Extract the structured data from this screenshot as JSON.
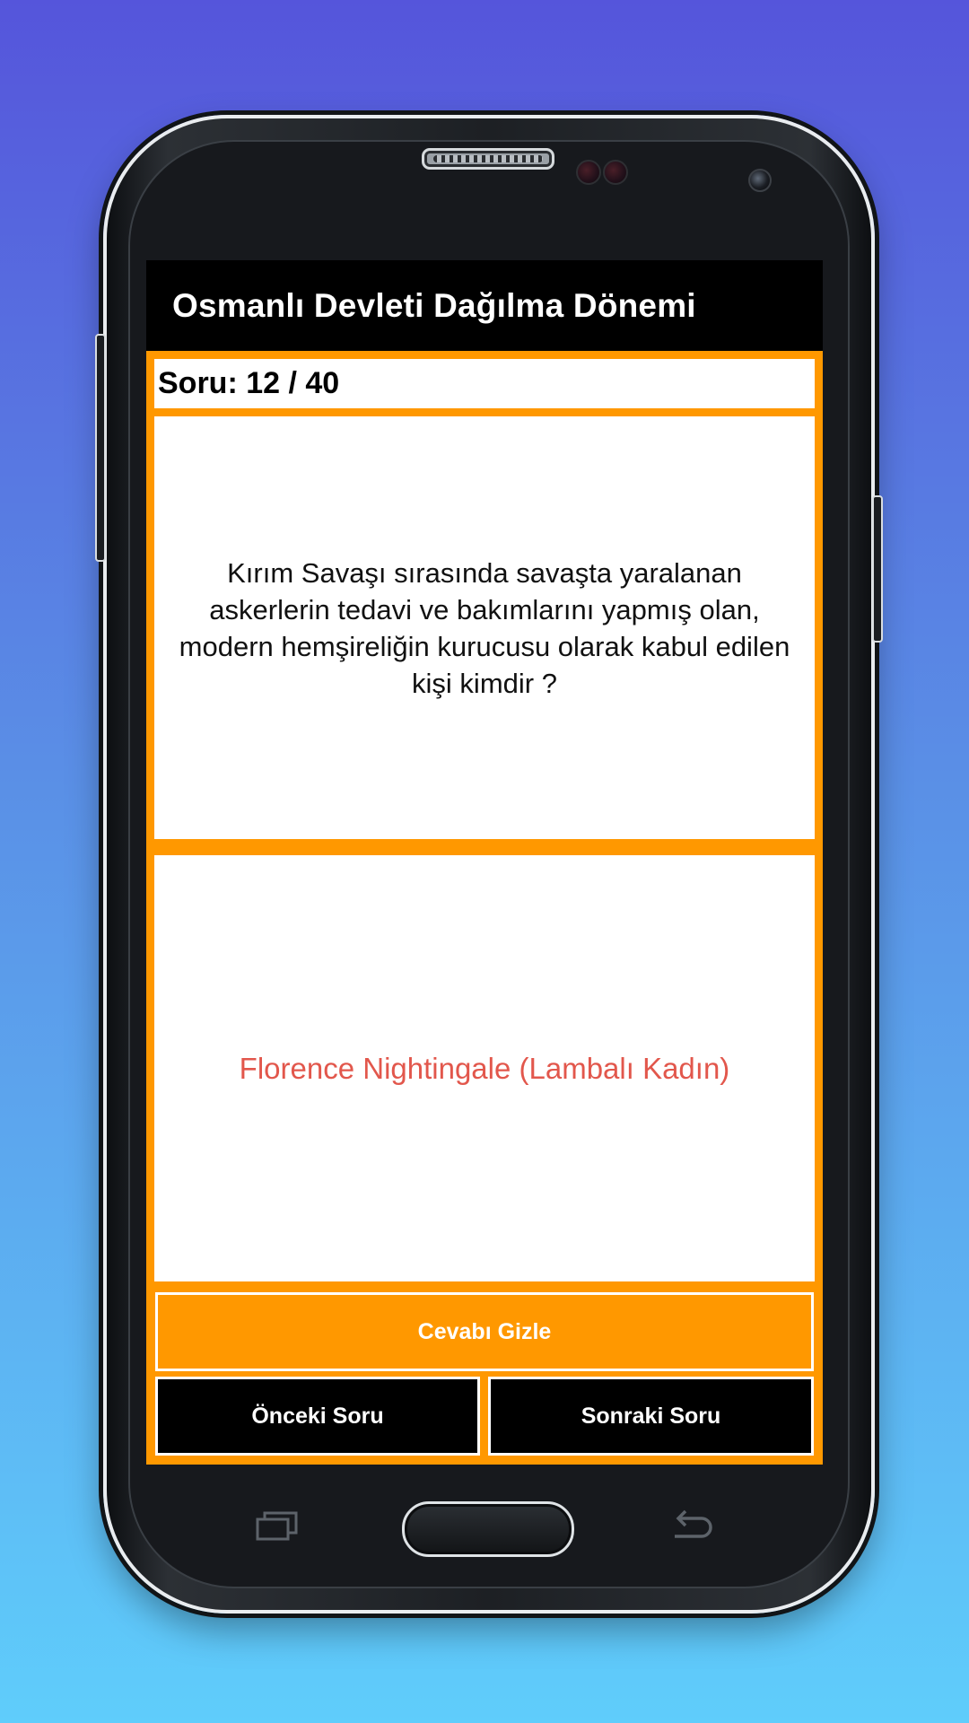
{
  "app": {
    "title": "Osmanlı Devleti Dağılma Dönemi"
  },
  "quiz": {
    "counter": "Soru: 12 / 40",
    "question": "Kırım Savaşı sırasında savaşta yaralanan askerlerin tedavi ve bakımlarını yapmış olan, modern hemşireliğin kurucusu olarak kabul edilen kişi kimdir ?",
    "answer": "Florence Nightingale (Lambalı Kadın)"
  },
  "buttons": {
    "hide_answer": "Cevabı Gizle",
    "previous": "Önceki Soru",
    "next": "Sonraki Soru"
  },
  "colors": {
    "accent": "#ff9800",
    "answer_text": "#e2574c",
    "app_bar": "#000000"
  },
  "device_keys": {
    "recent": "recent-apps-icon",
    "home": "home-button",
    "back": "back-icon"
  }
}
